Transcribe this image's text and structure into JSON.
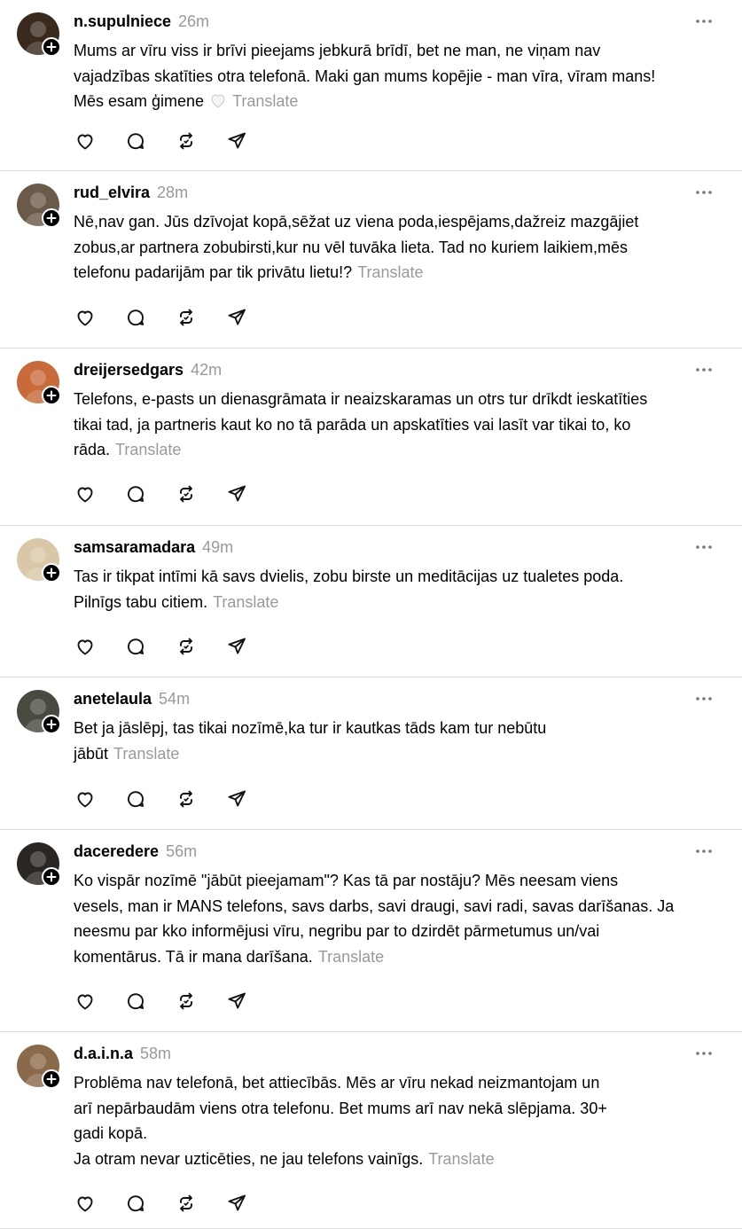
{
  "posts": [
    {
      "username": "n.supulniece",
      "time": "26m",
      "lines": [
        "Mums ar vīru viss ir brīvi pieejams jebkurā brīdī, bet ne man, ne viņam nav",
        "vajadzības skatīties otra telefonā. Maki gan mums kopējie - man vīra, vīram mans!",
        "Mēs esam ģimene"
      ],
      "has_heart_emoji": true,
      "translate": "Translate",
      "avatar_color": "#3a2a1e"
    },
    {
      "username": "rud_elvira",
      "time": "28m",
      "lines": [
        "Nē,nav gan. Jūs dzīvojat kopā,sēžat uz viena poda,iespējams,dažreiz mazgājiet",
        "zobus,ar partnera zobubirsti,kur nu vēl tuvāka lieta. Tad no kuriem laikiem,mēs",
        "telefonu padarijām par tik privātu lietu!?"
      ],
      "has_heart_emoji": false,
      "translate": "Translate",
      "avatar_color": "#6b5a4a"
    },
    {
      "username": "dreijersedgars",
      "time": "42m",
      "lines": [
        "Telefons, e-pasts un dienasgrāmata ir neaizskaramas un otrs tur drīkdt ieskatīties",
        "tikai tad, ja partneris kaut ko no tā parāda un apskatīties vai lasīt var tikai to, ko",
        "rāda."
      ],
      "has_heart_emoji": false,
      "translate": "Translate",
      "avatar_color": "#c96a3a"
    },
    {
      "username": "samsaramadara",
      "time": "49m",
      "lines": [
        "Tas ir tikpat intīmi kā savs dvielis, zobu birste un meditācijas uz tualetes poda.",
        "Pilnīgs tabu citiem."
      ],
      "has_heart_emoji": false,
      "translate": "Translate",
      "avatar_color": "#d9c7a8"
    },
    {
      "username": "anetelaula",
      "time": "54m",
      "lines": [
        "Bet ja jāslēpj, tas tikai nozīmē,ka tur ir kautkas tāds kam tur nebūtu",
        "jābūt"
      ],
      "has_heart_emoji": false,
      "translate": "Translate",
      "avatar_color": "#4a4a40"
    },
    {
      "username": "daceredere",
      "time": "56m",
      "lines": [
        "Ko vispār nozīmē \"jābūt pieejamam\"? Kas tā par nostāju? Mēs neesam viens",
        "vesels, man ir MANS telefons, savs darbs, savi draugi, savi radi, savas darīšanas. Ja",
        "neesmu par kko informējusi vīru, negribu par to dzirdēt pārmetumus un/vai",
        "komentārus. Tā ir mana darīšana."
      ],
      "has_heart_emoji": false,
      "translate": "Translate",
      "avatar_color": "#2a2622"
    },
    {
      "username": "d.a.i.n.a",
      "time": "58m",
      "lines": [
        "Problēma nav telefonā, bet attiecībās. Mēs ar vīru nekad neizmantojam un",
        "arī nepārbaudām viens otra telefonu. Bet mums arī nav nekā slēpjama. 30+",
        "gadi kopā.",
        "Ja otram nevar uzticēties, ne jau telefons vainīgs."
      ],
      "has_heart_emoji": false,
      "translate": "Translate",
      "avatar_color": "#8a6a4a"
    }
  ]
}
